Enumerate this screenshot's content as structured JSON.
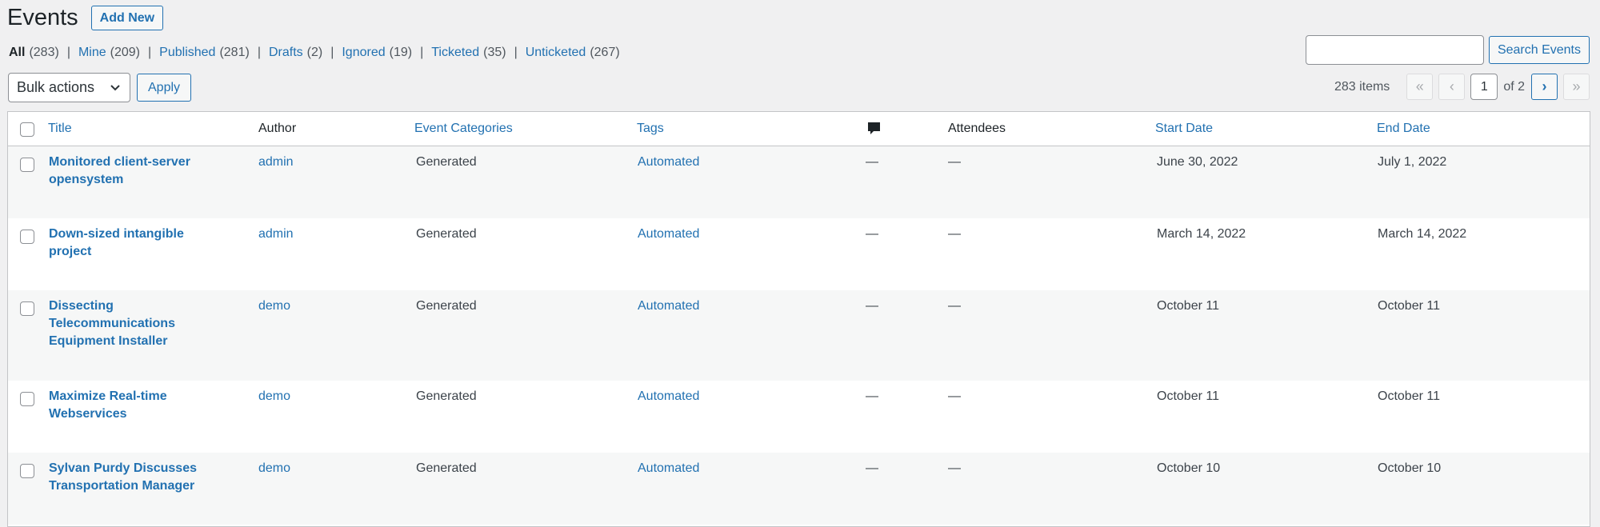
{
  "page": {
    "title": "Events",
    "add_new_label": "Add New"
  },
  "views": [
    {
      "label": "All",
      "count": "(283)",
      "current": true
    },
    {
      "label": "Mine",
      "count": "(209)"
    },
    {
      "label": "Published",
      "count": "(281)"
    },
    {
      "label": "Drafts",
      "count": "(2)"
    },
    {
      "label": "Ignored",
      "count": "(19)"
    },
    {
      "label": "Ticketed",
      "count": "(35)"
    },
    {
      "label": "Unticketed",
      "count": "(267)"
    }
  ],
  "view_separator": "|",
  "search": {
    "value": "",
    "button_label": "Search Events"
  },
  "bulk": {
    "selected": "Bulk actions",
    "apply_label": "Apply"
  },
  "pagination": {
    "items_label": "283 items",
    "first": "«",
    "prev": "‹",
    "current_page": "1",
    "of_total": "of 2",
    "next": "›",
    "last": "»"
  },
  "columns": {
    "title": "Title",
    "author": "Author",
    "categories": "Event Categories",
    "tags": "Tags",
    "comments_icon": "comment-bubble-icon",
    "attendees": "Attendees",
    "start": "Start Date",
    "end": "End Date"
  },
  "rows": [
    {
      "title_lines": [
        "Monitored client-server",
        "opensystem"
      ],
      "author": "admin",
      "category": "Generated",
      "tags": "Automated",
      "comments": "—",
      "attendees": "—",
      "start": "June 30, 2022",
      "end": "July 1, 2022"
    },
    {
      "title_lines": [
        "Down-sized intangible",
        "project"
      ],
      "author": "admin",
      "category": "Generated",
      "tags": "Automated",
      "comments": "—",
      "attendees": "—",
      "start": "March 14, 2022",
      "end": "March 14, 2022"
    },
    {
      "title_lines": [
        "Dissecting",
        "Telecommunications",
        "Equipment Installer"
      ],
      "author": "demo",
      "category": "Generated",
      "tags": "Automated",
      "comments": "—",
      "attendees": "—",
      "start": "October 11",
      "end": "October 11"
    },
    {
      "title_lines": [
        "Maximize Real-time",
        "Webservices"
      ],
      "author": "demo",
      "category": "Generated",
      "tags": "Automated",
      "comments": "—",
      "attendees": "—",
      "start": "October 11",
      "end": "October 11"
    },
    {
      "title_lines": [
        "Sylvan Purdy Discusses",
        "Transportation Manager"
      ],
      "author": "demo",
      "category": "Generated",
      "tags": "Automated",
      "comments": "—",
      "attendees": "—",
      "start": "October 10",
      "end": "October 10"
    }
  ],
  "colors": {
    "link": "#2271b1",
    "background": "#f0f0f1",
    "row_alt": "#f6f7f7"
  }
}
